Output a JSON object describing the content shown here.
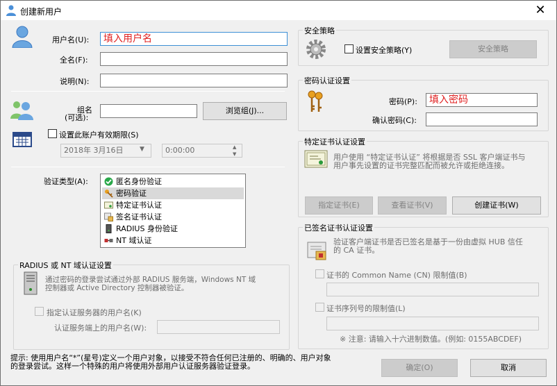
{
  "title": "创建新用户",
  "labels": {
    "username": "用户名(U):",
    "fullname": "全名(F):",
    "description": "说明(N):",
    "group": "组名",
    "group_opt": "(可选):",
    "expire": "设置此账户有效期限(S)",
    "auth_type": "验证类型(A):"
  },
  "inputs": {
    "username": "填入用户名",
    "fullname": "",
    "description": "",
    "group": "",
    "date": "2018年 3月16日",
    "time": "0:00:00"
  },
  "buttons": {
    "browse": "浏览组(J)...",
    "policy": "安全策略",
    "specify_cert": "指定证书(E)",
    "view_cert": "查看证书(V)",
    "create_cert": "创建证书(W)",
    "ok": "确定(O)",
    "cancel": "取消"
  },
  "auth_types": [
    {
      "label": "匿名身份验证",
      "icon": "check-icon"
    },
    {
      "label": "密码验证",
      "icon": "key-icon"
    },
    {
      "label": "特定证书认证",
      "icon": "certificate-icon"
    },
    {
      "label": "签名证书认证",
      "icon": "signed-cert-icon"
    },
    {
      "label": "RADIUS 身份验证",
      "icon": "server-icon"
    },
    {
      "label": "NT 域认证",
      "icon": "network-icon"
    }
  ],
  "selected_auth": 1,
  "radius": {
    "title": "RADIUS 或 NT 域认证设置",
    "desc1": "通过密码的登录尝试通过外部 RADIUS 服务端，Windows NT 域",
    "desc2": "控制器或 Active Directory 控制器被验证。",
    "specify_name": "指定认证服务器的用户名(K)",
    "server_name": "认证服务端上的用户名(W):",
    "server_value": ""
  },
  "security": {
    "title": "安全策略",
    "checkbox": "设置安全策略(Y)"
  },
  "password": {
    "title": "密码认证设置",
    "pw_label": "密码(P):",
    "pw_value": "填入密码",
    "confirm_label": "确认密码(C):",
    "confirm_value": ""
  },
  "cert": {
    "title": "特定证书认证设置",
    "desc1": "用户使用 “特定证书认证” 将根据是否 SSL 客户端证书与",
    "desc2": "用户事先设置的证书完整匹配而被允许或拒绝连接。"
  },
  "signed": {
    "title": "已签名证书认证设置",
    "desc1": "验证客户端证书是否已签名是基于一份由虚拟 HUB 信任",
    "desc2": "的 CA 证书。",
    "cn_label": "证书的 Common Name (CN) 限制值(B)",
    "cn_value": "",
    "serial_label": "证书序列号的限制值(L)",
    "serial_value": "",
    "note": "※ 注意: 请输入十六进制数值。(例如: 0155ABCDEF)"
  },
  "hint1": "提示: 使用用户名“*”(星号)定义一个用户对象，以接受不符合任何已注册的、明确的、用户对象",
  "hint2": "的登录尝试。这样一个特殊的用户将使用外部用户认证服务器验证登录。",
  "colors": {
    "placeholder_red": "#e02020",
    "focus_border": "#3c8fd5"
  }
}
